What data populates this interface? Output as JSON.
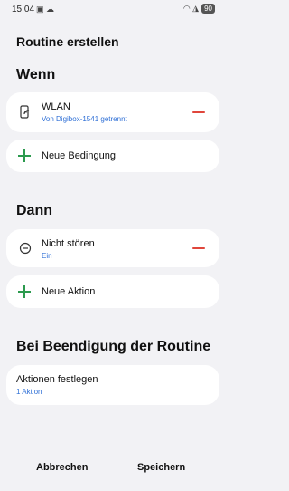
{
  "status": {
    "time": "15:04",
    "left_icons": "▣ ☁",
    "right_icons": "◠ ◮",
    "battery": "90"
  },
  "page": {
    "title": "Routine erstellen"
  },
  "when": {
    "title": "Wenn",
    "condition": {
      "title": "WLAN",
      "subtitle": "Von Digibox-1541 getrennt"
    },
    "add_label": "Neue Bedingung"
  },
  "then": {
    "title": "Dann",
    "action": {
      "title": "Nicht stören",
      "subtitle": "Ein"
    },
    "add_label": "Neue Aktion"
  },
  "end": {
    "title": "Bei Beendigung der Routine",
    "item": {
      "title": "Aktionen festlegen",
      "subtitle": "1 Aktion"
    }
  },
  "footer": {
    "cancel": "Abbrechen",
    "save": "Speichern"
  },
  "colors": {
    "accent_blue": "#2e6fd6",
    "remove_red": "#e0463b",
    "add_green": "#2c9a4e",
    "background": "#f2f2f5"
  }
}
